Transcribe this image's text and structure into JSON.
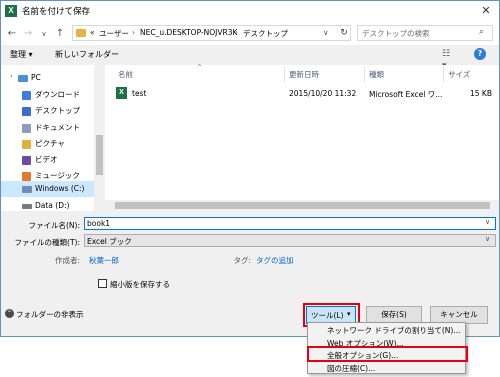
{
  "window": {
    "title": "名前を付けて保存",
    "app_icon": "X",
    "close_icon": "✕"
  },
  "address": {
    "prefix": "«",
    "segments": [
      "ユーザー",
      "NEC_u.DESKTOP-NOJVR3K",
      "デスクトップ"
    ],
    "separator": "›",
    "dropdown": "∨",
    "refresh": "↻"
  },
  "search": {
    "placeholder": "デスクトップの検索",
    "icon": "⌕"
  },
  "toolbar": {
    "organize": "整理 ▾",
    "new_folder": "新しいフォルダー",
    "view_icon": "☷ ▾",
    "help": "?"
  },
  "nav": {
    "items": [
      {
        "label": "PC",
        "color": "#4a90d9"
      },
      {
        "label": "ダウンロード",
        "color": "#3b7dd8"
      },
      {
        "label": "デスクトップ",
        "color": "#3a6fc9"
      },
      {
        "label": "ドキュメント",
        "color": "#8c9db5"
      },
      {
        "label": "ピクチャ",
        "color": "#e0b03c"
      },
      {
        "label": "ビデオ",
        "color": "#6b4f9e"
      },
      {
        "label": "ミュージック",
        "color": "#e07b2b"
      },
      {
        "label": "Windows (C:)",
        "color": "#6d8fb3"
      },
      {
        "label": "Data (D:)",
        "color": "#7a7a7a"
      }
    ]
  },
  "columns": {
    "name": "名前",
    "modified": "更新日時",
    "type": "種類",
    "size": "サイズ",
    "sort_indicator": "^"
  },
  "files": [
    {
      "icon": "X",
      "name": "test",
      "modified": "2015/10/20 11:32",
      "type": "Microsoft Excel ワ...",
      "size": "15 KB"
    }
  ],
  "form": {
    "filename_label": "ファイル名(N):",
    "filename_value": "book1",
    "filetype_label": "ファイルの種類(T):",
    "filetype_value": "Excel ブック",
    "author_label": "作成者:",
    "author_value": "秋葉一郎",
    "tags_label": "タグ:",
    "tags_value": "タグの追加",
    "thumbnail_label": "縮小版を保存する",
    "dropdown": "∨"
  },
  "footer": {
    "hide_folders": "フォルダーの非表示",
    "tools": "ツール(L)",
    "tools_arrow": "▾",
    "save": "保存(S)",
    "cancel": "キャンセル"
  },
  "tools_menu": {
    "items": [
      "ネットワーク ドライブの割り当て(N)...",
      "Web オプション(W)...",
      "全般オプション(G)...",
      "図の圧縮(C)..."
    ]
  },
  "highlight_color": "#e60012",
  "accent_color": "#0078d7"
}
